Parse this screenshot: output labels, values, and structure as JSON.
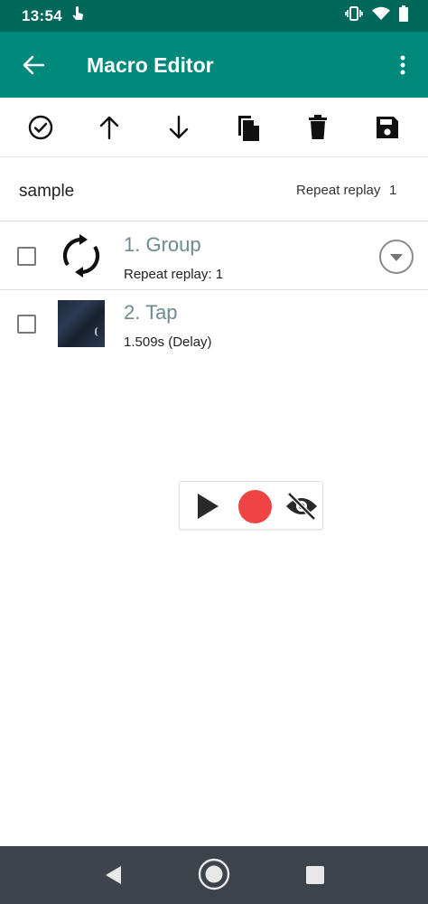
{
  "status_bar": {
    "time": "13:54",
    "icons": [
      "touch-icon",
      "vibrate-icon",
      "wifi-icon",
      "battery-icon"
    ]
  },
  "app_bar": {
    "title": "Macro Editor",
    "icons": [
      "back-arrow-icon",
      "more-vert-icon"
    ]
  },
  "toolbar": {
    "icons": [
      "select-all-icon",
      "move-up-icon",
      "move-down-icon",
      "copy-icon",
      "delete-icon",
      "save-icon"
    ]
  },
  "macro": {
    "name": "sample",
    "repeat_label": "Repeat replay",
    "repeat_value": "1"
  },
  "actions": [
    {
      "title": "1. Group",
      "subtitle": "Repeat replay: 1",
      "icon": "sync-icon"
    },
    {
      "title": "2. Tap",
      "subtitle": "1.509s (Delay)",
      "icon": "thumbnail-image"
    }
  ],
  "floating_controls": {
    "icons": [
      "play-icon",
      "record-icon",
      "visibility-off-icon"
    ],
    "record_color": "#ef4444"
  },
  "colors": {
    "status_bar": "#00675b",
    "app_bar": "#00897b",
    "row_title": "#6c8a90",
    "nav_bar": "#3d434a"
  },
  "nav_bar": {
    "icons": [
      "nav-back-icon",
      "nav-home-icon",
      "nav-recents-icon"
    ]
  }
}
